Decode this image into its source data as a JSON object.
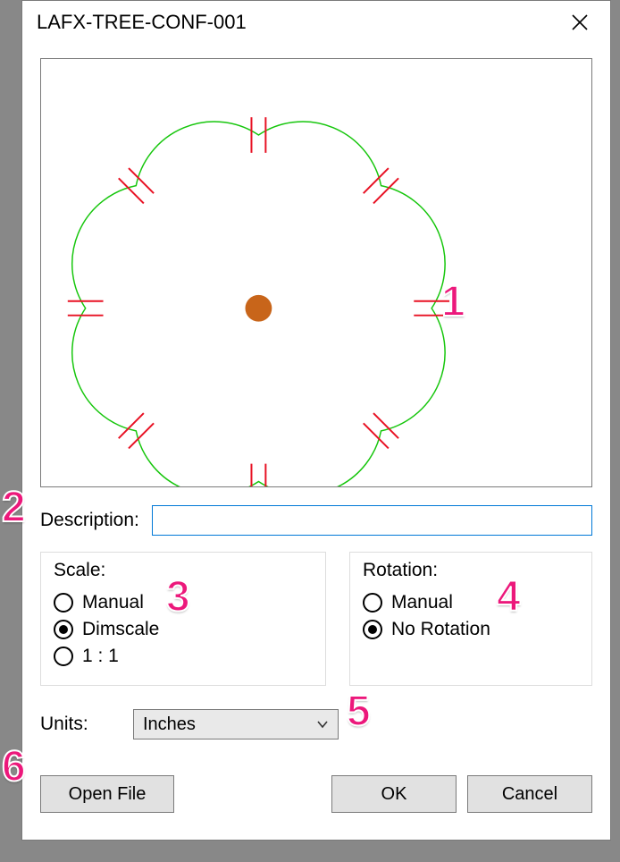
{
  "window": {
    "title": "LAFX-TREE-CONF-001"
  },
  "callouts": {
    "c1": "1",
    "c2": "2",
    "c3": "3",
    "c4": "4",
    "c5": "5",
    "c6": "6"
  },
  "description": {
    "label": "Description:",
    "value": ""
  },
  "scale": {
    "title": "Scale:",
    "options": {
      "manual": "Manual",
      "dimscale": "Dimscale",
      "one_to_one": "1 : 1"
    },
    "selected": "dimscale"
  },
  "rotation": {
    "title": "Rotation:",
    "options": {
      "manual": "Manual",
      "none": "No Rotation"
    },
    "selected": "none"
  },
  "units": {
    "label": "Units:",
    "value": "Inches"
  },
  "buttons": {
    "open_file": "Open File",
    "ok": "OK",
    "cancel": "Cancel"
  }
}
